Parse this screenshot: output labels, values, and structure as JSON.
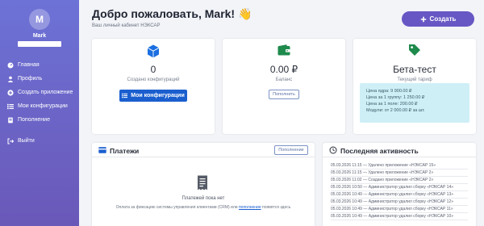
{
  "user": {
    "initial": "M",
    "name": "Mark"
  },
  "sidebar": {
    "items": [
      {
        "label": "Главная",
        "icon": "dashboard-icon"
      },
      {
        "label": "Профиль",
        "icon": "user-icon"
      },
      {
        "label": "Создать приложение",
        "icon": "plus-circle-icon"
      },
      {
        "label": "Мои конфигурации",
        "icon": "list-icon"
      },
      {
        "label": "Пополнение",
        "icon": "wallet-icon"
      }
    ],
    "logout_label": "Выйти"
  },
  "header": {
    "title": "Добро пожаловать, Mark! 👋",
    "subtitle": "Ваш личный кабинет НЭКСАР",
    "create_label": "Создать"
  },
  "stats": {
    "configs": {
      "value": "0",
      "label": "Создано конфигураций",
      "button": "Мои конфигурации"
    },
    "balance": {
      "value": "0.00 ₽",
      "label": "Баланс",
      "button": "Пополнить"
    },
    "tariff": {
      "value": "Бета-тест",
      "label": "Текущий тариф",
      "prices": [
        "Цена ядра: 9 900.00 ₽",
        "Цена за 1 группу: 1 250.00 ₽",
        "Цена за 1 поле: 200.00 ₽",
        "Модули: от 2 000.00 ₽ за шт."
      ]
    }
  },
  "payments": {
    "title": "Платежи",
    "button": "Пополнение",
    "empty_title": "Платежей пока нет",
    "empty_text_before": "Оплата за фиксацию системы управления клиентами (CRM) или",
    "empty_link": "пополнение",
    "empty_text_after": "появятся здесь"
  },
  "activity": {
    "title": "Последняя активность",
    "items": [
      "05.03.2026 11:15 — Удалено приложение «НЭКСАР 15»",
      "05.03.2026 11:15 — Удалено приложение «НЭКСАР 2»",
      "05.03.2026 11:02 — Создано приложение «НЭКСАР 2»",
      "05.03.2026 10:50 — Администратор удалил сборку «НЭКСАР 14»",
      "05.03.2026 10:49 — Администратор удалил сборку «НЭКСАР 13»",
      "05.03.2026 10:49 — Администратор удалил сборку «НЭКСАР 12»",
      "05.03.2026 10:49 — Администратор удалил сборку «НЭКСАР 11»",
      "05.03.2026 10:49 — Администратор удалил сборку «НЭКСАР 10»"
    ]
  },
  "colors": {
    "sidebar_top": "#6d72d6",
    "sidebar_bottom": "#6a58b8",
    "primary_button": "#1b5fcf",
    "create_button": "#6757c4",
    "tariff_box": "#cfeff7",
    "configs_icon": "#1b6fe0",
    "balance_icon": "#1e8a4c",
    "tariff_icon": "#1e8a4c"
  }
}
